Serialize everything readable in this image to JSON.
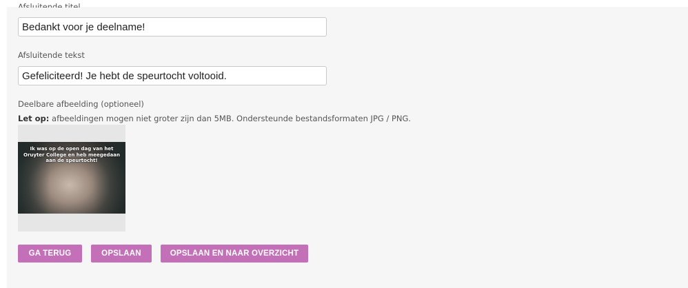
{
  "form": {
    "closing_title_label": "Afsluitende titel",
    "closing_title_value": "Bedankt voor je deelname!",
    "closing_text_label": "Afsluitende tekst",
    "closing_text_value": "Gefeliciteerd! Je hebt de speurtocht voltooid.",
    "image_label": "Deelbare afbeelding (optioneel)",
    "note_prefix": "Let op:",
    "note_text": " afbeeldingen mogen niet groter zijn dan 5MB. Ondersteunde bestandsformaten JPG / PNG.",
    "image_caption": "Ik was op de open dag van het Oruyter College en heb meegedaan aan de speurtocht!"
  },
  "buttons": {
    "back": "GA TERUG",
    "save": "OPSLAAN",
    "save_overview": "OPSLAAN EN NAAR OVERZICHT"
  },
  "colors": {
    "button_bg": "#c470b8",
    "panel_bg": "#f6f6f6"
  }
}
